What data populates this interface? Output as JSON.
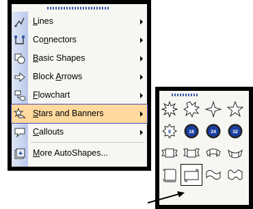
{
  "menu": {
    "items": [
      {
        "pre": "",
        "key": "L",
        "post": "ines",
        "icon": "lines-icon"
      },
      {
        "pre": "Co",
        "key": "n",
        "post": "nectors",
        "icon": "connectors-icon"
      },
      {
        "pre": "",
        "key": "B",
        "post": "asic Shapes",
        "icon": "basic-shapes-icon"
      },
      {
        "pre": "Block ",
        "key": "A",
        "post": "rrows",
        "icon": "block-arrows-icon"
      },
      {
        "pre": "",
        "key": "F",
        "post": "lowchart",
        "icon": "flowchart-icon"
      },
      {
        "pre": "",
        "key": "S",
        "post": "tars and Banners",
        "icon": "stars-banners-icon"
      },
      {
        "pre": "",
        "key": "C",
        "post": "allouts",
        "icon": "callouts-icon"
      },
      {
        "pre": "",
        "key": "M",
        "post": "ore AutoShapes...",
        "icon": "more-autoshapes-icon"
      }
    ],
    "highlighted_index": 5
  },
  "submenu": {
    "title": "Stars and Banners",
    "badges": [
      "8",
      "16",
      "24",
      "32"
    ]
  },
  "colors": {
    "highlight": "#ffd99e",
    "accent": "#3a5aa8",
    "badge": "#1a3fa0"
  }
}
